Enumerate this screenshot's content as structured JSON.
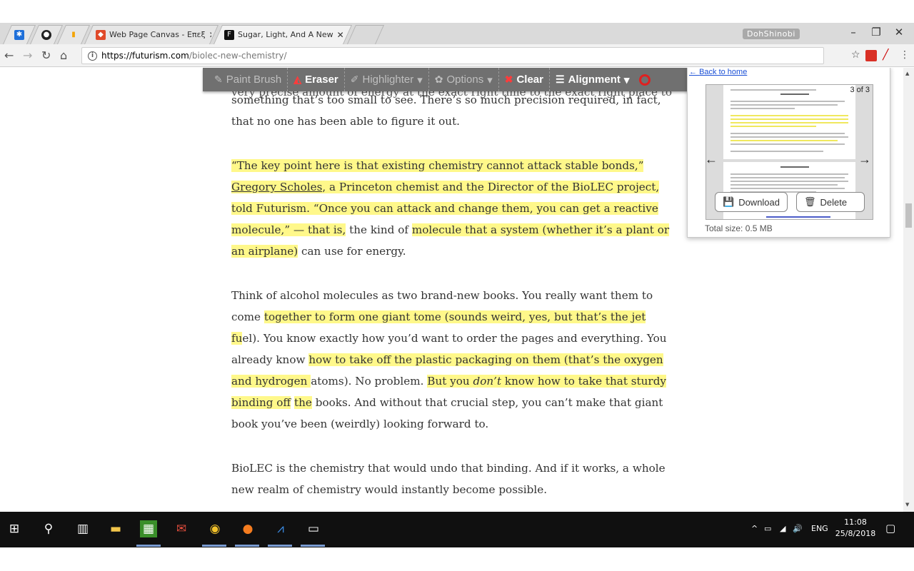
{
  "browser": {
    "tabs": [
      {
        "title": "",
        "icon": "puzzle-icon"
      },
      {
        "title": "",
        "icon": "github-icon"
      },
      {
        "title": "",
        "icon": "analytics-icon"
      },
      {
        "title": "Web Page Canvas - Επεξ",
        "icon": "canvas-icon"
      },
      {
        "title": "Sugar, Light, And A New",
        "icon": "futurism-icon"
      }
    ],
    "user": "DohShinobi",
    "url_host": "https://futurism.com",
    "url_path": "/biolec-new-chemistry/"
  },
  "annotation_toolbar": {
    "paint_brush": "Paint Brush",
    "eraser": "Eraser",
    "highlighter": "Highlighter",
    "options": "Options",
    "clear": "Clear",
    "alignment": "Alignment"
  },
  "article": {
    "partial_top": "very precise amount of energy at the exact right time to the exact right place to",
    "p1": "something that’s too small to see. There’s so much precision required, in fact, that no one has been able to figure it out.",
    "p2_hl1": "“The key point here is that existing chemistry cannot attack stable bonds,” ",
    "p2_link": "Gregory Scholes",
    "p2_hl2": ", a Princeton chemist and the Director of the BioLEC project, told Futurism. “Once you can attack and change them, you can get a reactive molecule,” — that is,",
    "p2_plain1": " the kind of ",
    "p2_hl3": "molecule that a system (whether it’s a plant or an airplane)",
    "p2_plain2": " can use for energy.",
    "p3_plain1": "Think of alcohol molecules as two brand-new books. You really want them to come ",
    "p3_hl1": "together to form one giant tome (sounds weird, yes, but that’s the jet fu",
    "p3_plain2": "el). You know exactly how you’d want to order the pages and everything. You already know ",
    "p3_hl2": "how to take off the plastic packaging on them (that’s the oxygen and hydrogen ",
    "p3_plain3": "atoms). No problem. ",
    "p3_hl3a": "But you ",
    "p3_hl3em": "don’t",
    "p3_hl3b": " know how to take that sturdy binding off",
    "p3_plain4": " ",
    "p3_hl4": "the",
    "p3_plain5": " books. And without that crucial step, you can’t make that giant book you’ve been (weirdly) looking forward to.",
    "p4": "BioLEC is the chemistry that would undo that binding. And if it works, a whole new realm of chemistry would instantly become possible."
  },
  "popup": {
    "back_link": "Back to home",
    "counter": "3 of 3",
    "download": "Download",
    "delete": "Delete",
    "total_size": "Total size: 0.5 MB"
  },
  "taskbar": {
    "lang": "ENG",
    "time": "11:08",
    "date": "25/8/2018"
  },
  "colors": {
    "highlight": "#fff88a",
    "clear_x": "#ff3b3b",
    "eraser_icon": "#ff3b3b"
  }
}
